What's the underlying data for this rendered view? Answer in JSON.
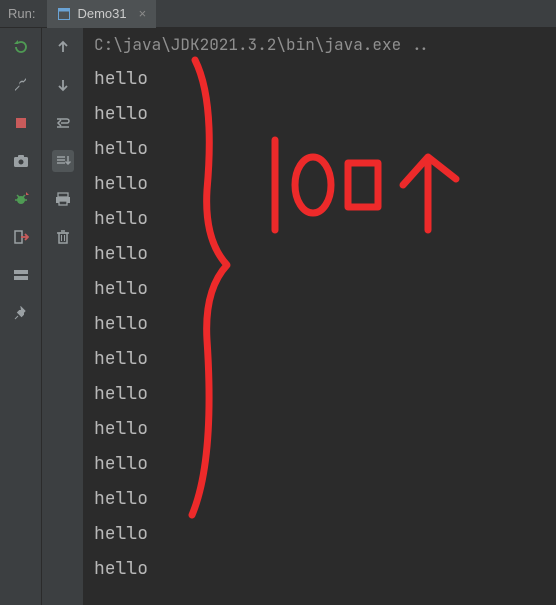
{
  "header": {
    "run_label": "Run:",
    "tab_name": "Demo31",
    "tab_close": "×"
  },
  "toolbar_left": {
    "rerun": "rerun-icon",
    "build": "wrench-icon",
    "stop": "stop-icon",
    "camera": "camera-icon",
    "debug": "bug-icon",
    "exit": "exit-icon",
    "layout": "layout-icon",
    "pin": "pin-icon"
  },
  "toolbar_mid": {
    "up": "arrow-up-icon",
    "down": "arrow-down-icon",
    "wrap": "wrap-icon",
    "scroll": "scroll-to-end-icon",
    "print": "print-icon",
    "trash": "trash-icon"
  },
  "console": {
    "command": "C:\\java\\JDK2021.3.2\\bin\\java.exe ..",
    "output_line": "hello",
    "output_count": 15
  },
  "annotation": {
    "text": "100个"
  }
}
